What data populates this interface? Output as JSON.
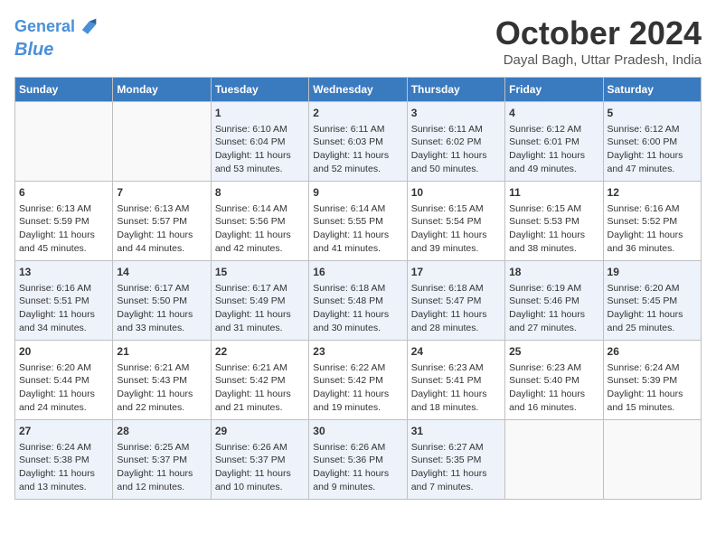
{
  "header": {
    "logo_line1": "General",
    "logo_line2": "Blue",
    "month": "October 2024",
    "location": "Dayal Bagh, Uttar Pradesh, India"
  },
  "days_of_week": [
    "Sunday",
    "Monday",
    "Tuesday",
    "Wednesday",
    "Thursday",
    "Friday",
    "Saturday"
  ],
  "weeks": [
    [
      {
        "day": "",
        "info": ""
      },
      {
        "day": "",
        "info": ""
      },
      {
        "day": "1",
        "info": "Sunrise: 6:10 AM\nSunset: 6:04 PM\nDaylight: 11 hours and 53 minutes."
      },
      {
        "day": "2",
        "info": "Sunrise: 6:11 AM\nSunset: 6:03 PM\nDaylight: 11 hours and 52 minutes."
      },
      {
        "day": "3",
        "info": "Sunrise: 6:11 AM\nSunset: 6:02 PM\nDaylight: 11 hours and 50 minutes."
      },
      {
        "day": "4",
        "info": "Sunrise: 6:12 AM\nSunset: 6:01 PM\nDaylight: 11 hours and 49 minutes."
      },
      {
        "day": "5",
        "info": "Sunrise: 6:12 AM\nSunset: 6:00 PM\nDaylight: 11 hours and 47 minutes."
      }
    ],
    [
      {
        "day": "6",
        "info": "Sunrise: 6:13 AM\nSunset: 5:59 PM\nDaylight: 11 hours and 45 minutes."
      },
      {
        "day": "7",
        "info": "Sunrise: 6:13 AM\nSunset: 5:57 PM\nDaylight: 11 hours and 44 minutes."
      },
      {
        "day": "8",
        "info": "Sunrise: 6:14 AM\nSunset: 5:56 PM\nDaylight: 11 hours and 42 minutes."
      },
      {
        "day": "9",
        "info": "Sunrise: 6:14 AM\nSunset: 5:55 PM\nDaylight: 11 hours and 41 minutes."
      },
      {
        "day": "10",
        "info": "Sunrise: 6:15 AM\nSunset: 5:54 PM\nDaylight: 11 hours and 39 minutes."
      },
      {
        "day": "11",
        "info": "Sunrise: 6:15 AM\nSunset: 5:53 PM\nDaylight: 11 hours and 38 minutes."
      },
      {
        "day": "12",
        "info": "Sunrise: 6:16 AM\nSunset: 5:52 PM\nDaylight: 11 hours and 36 minutes."
      }
    ],
    [
      {
        "day": "13",
        "info": "Sunrise: 6:16 AM\nSunset: 5:51 PM\nDaylight: 11 hours and 34 minutes."
      },
      {
        "day": "14",
        "info": "Sunrise: 6:17 AM\nSunset: 5:50 PM\nDaylight: 11 hours and 33 minutes."
      },
      {
        "day": "15",
        "info": "Sunrise: 6:17 AM\nSunset: 5:49 PM\nDaylight: 11 hours and 31 minutes."
      },
      {
        "day": "16",
        "info": "Sunrise: 6:18 AM\nSunset: 5:48 PM\nDaylight: 11 hours and 30 minutes."
      },
      {
        "day": "17",
        "info": "Sunrise: 6:18 AM\nSunset: 5:47 PM\nDaylight: 11 hours and 28 minutes."
      },
      {
        "day": "18",
        "info": "Sunrise: 6:19 AM\nSunset: 5:46 PM\nDaylight: 11 hours and 27 minutes."
      },
      {
        "day": "19",
        "info": "Sunrise: 6:20 AM\nSunset: 5:45 PM\nDaylight: 11 hours and 25 minutes."
      }
    ],
    [
      {
        "day": "20",
        "info": "Sunrise: 6:20 AM\nSunset: 5:44 PM\nDaylight: 11 hours and 24 minutes."
      },
      {
        "day": "21",
        "info": "Sunrise: 6:21 AM\nSunset: 5:43 PM\nDaylight: 11 hours and 22 minutes."
      },
      {
        "day": "22",
        "info": "Sunrise: 6:21 AM\nSunset: 5:42 PM\nDaylight: 11 hours and 21 minutes."
      },
      {
        "day": "23",
        "info": "Sunrise: 6:22 AM\nSunset: 5:42 PM\nDaylight: 11 hours and 19 minutes."
      },
      {
        "day": "24",
        "info": "Sunrise: 6:23 AM\nSunset: 5:41 PM\nDaylight: 11 hours and 18 minutes."
      },
      {
        "day": "25",
        "info": "Sunrise: 6:23 AM\nSunset: 5:40 PM\nDaylight: 11 hours and 16 minutes."
      },
      {
        "day": "26",
        "info": "Sunrise: 6:24 AM\nSunset: 5:39 PM\nDaylight: 11 hours and 15 minutes."
      }
    ],
    [
      {
        "day": "27",
        "info": "Sunrise: 6:24 AM\nSunset: 5:38 PM\nDaylight: 11 hours and 13 minutes."
      },
      {
        "day": "28",
        "info": "Sunrise: 6:25 AM\nSunset: 5:37 PM\nDaylight: 11 hours and 12 minutes."
      },
      {
        "day": "29",
        "info": "Sunrise: 6:26 AM\nSunset: 5:37 PM\nDaylight: 11 hours and 10 minutes."
      },
      {
        "day": "30",
        "info": "Sunrise: 6:26 AM\nSunset: 5:36 PM\nDaylight: 11 hours and 9 minutes."
      },
      {
        "day": "31",
        "info": "Sunrise: 6:27 AM\nSunset: 5:35 PM\nDaylight: 11 hours and 7 minutes."
      },
      {
        "day": "",
        "info": ""
      },
      {
        "day": "",
        "info": ""
      }
    ]
  ]
}
